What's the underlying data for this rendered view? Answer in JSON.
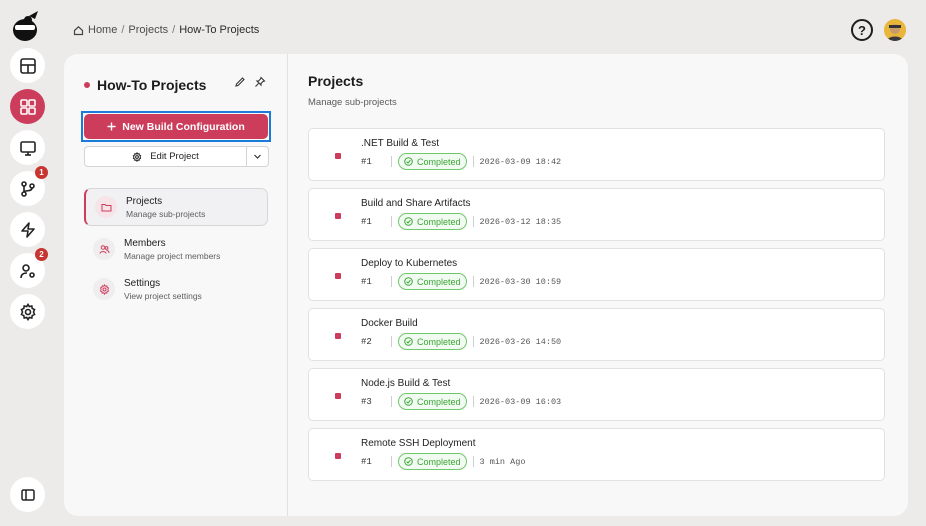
{
  "breadcrumb": {
    "home": "Home",
    "sep1": "/",
    "projects": "Projects",
    "sep2": "/",
    "current": "How-To Projects"
  },
  "topbar": {
    "help": "?"
  },
  "rail": {
    "badges": {
      "branches": "1",
      "users": "2"
    }
  },
  "project": {
    "name": "How-To Projects",
    "new_build_label": "New Build Configuration",
    "edit_label": "Edit Project"
  },
  "nav": [
    {
      "label": "Projects",
      "sub": "Manage sub-projects"
    },
    {
      "label": "Members",
      "sub": "Manage project members"
    },
    {
      "label": "Settings",
      "sub": "View project settings"
    }
  ],
  "main": {
    "title": "Projects",
    "subtitle": "Manage sub-projects",
    "rows": [
      {
        "name": ".NET Build & Test",
        "num": "#1",
        "status": "Completed",
        "time": "2026-03-09 18:42"
      },
      {
        "name": "Build and Share Artifacts",
        "num": "#1",
        "status": "Completed",
        "time": "2026-03-12 18:35"
      },
      {
        "name": "Deploy to Kubernetes",
        "num": "#1",
        "status": "Completed",
        "time": "2026-03-30 10:59"
      },
      {
        "name": "Docker Build",
        "num": "#2",
        "status": "Completed",
        "time": "2026-03-26 14:50"
      },
      {
        "name": "Node.js Build & Test",
        "num": "#3",
        "status": "Completed",
        "time": "2026-03-09 16:03"
      },
      {
        "name": "Remote SSH Deployment",
        "num": "#1",
        "status": "Completed",
        "time": "3 min Ago"
      }
    ]
  },
  "colors": {
    "accent": "#cc3d5c",
    "success": "#3ba536",
    "focus": "#1a7bd8"
  }
}
